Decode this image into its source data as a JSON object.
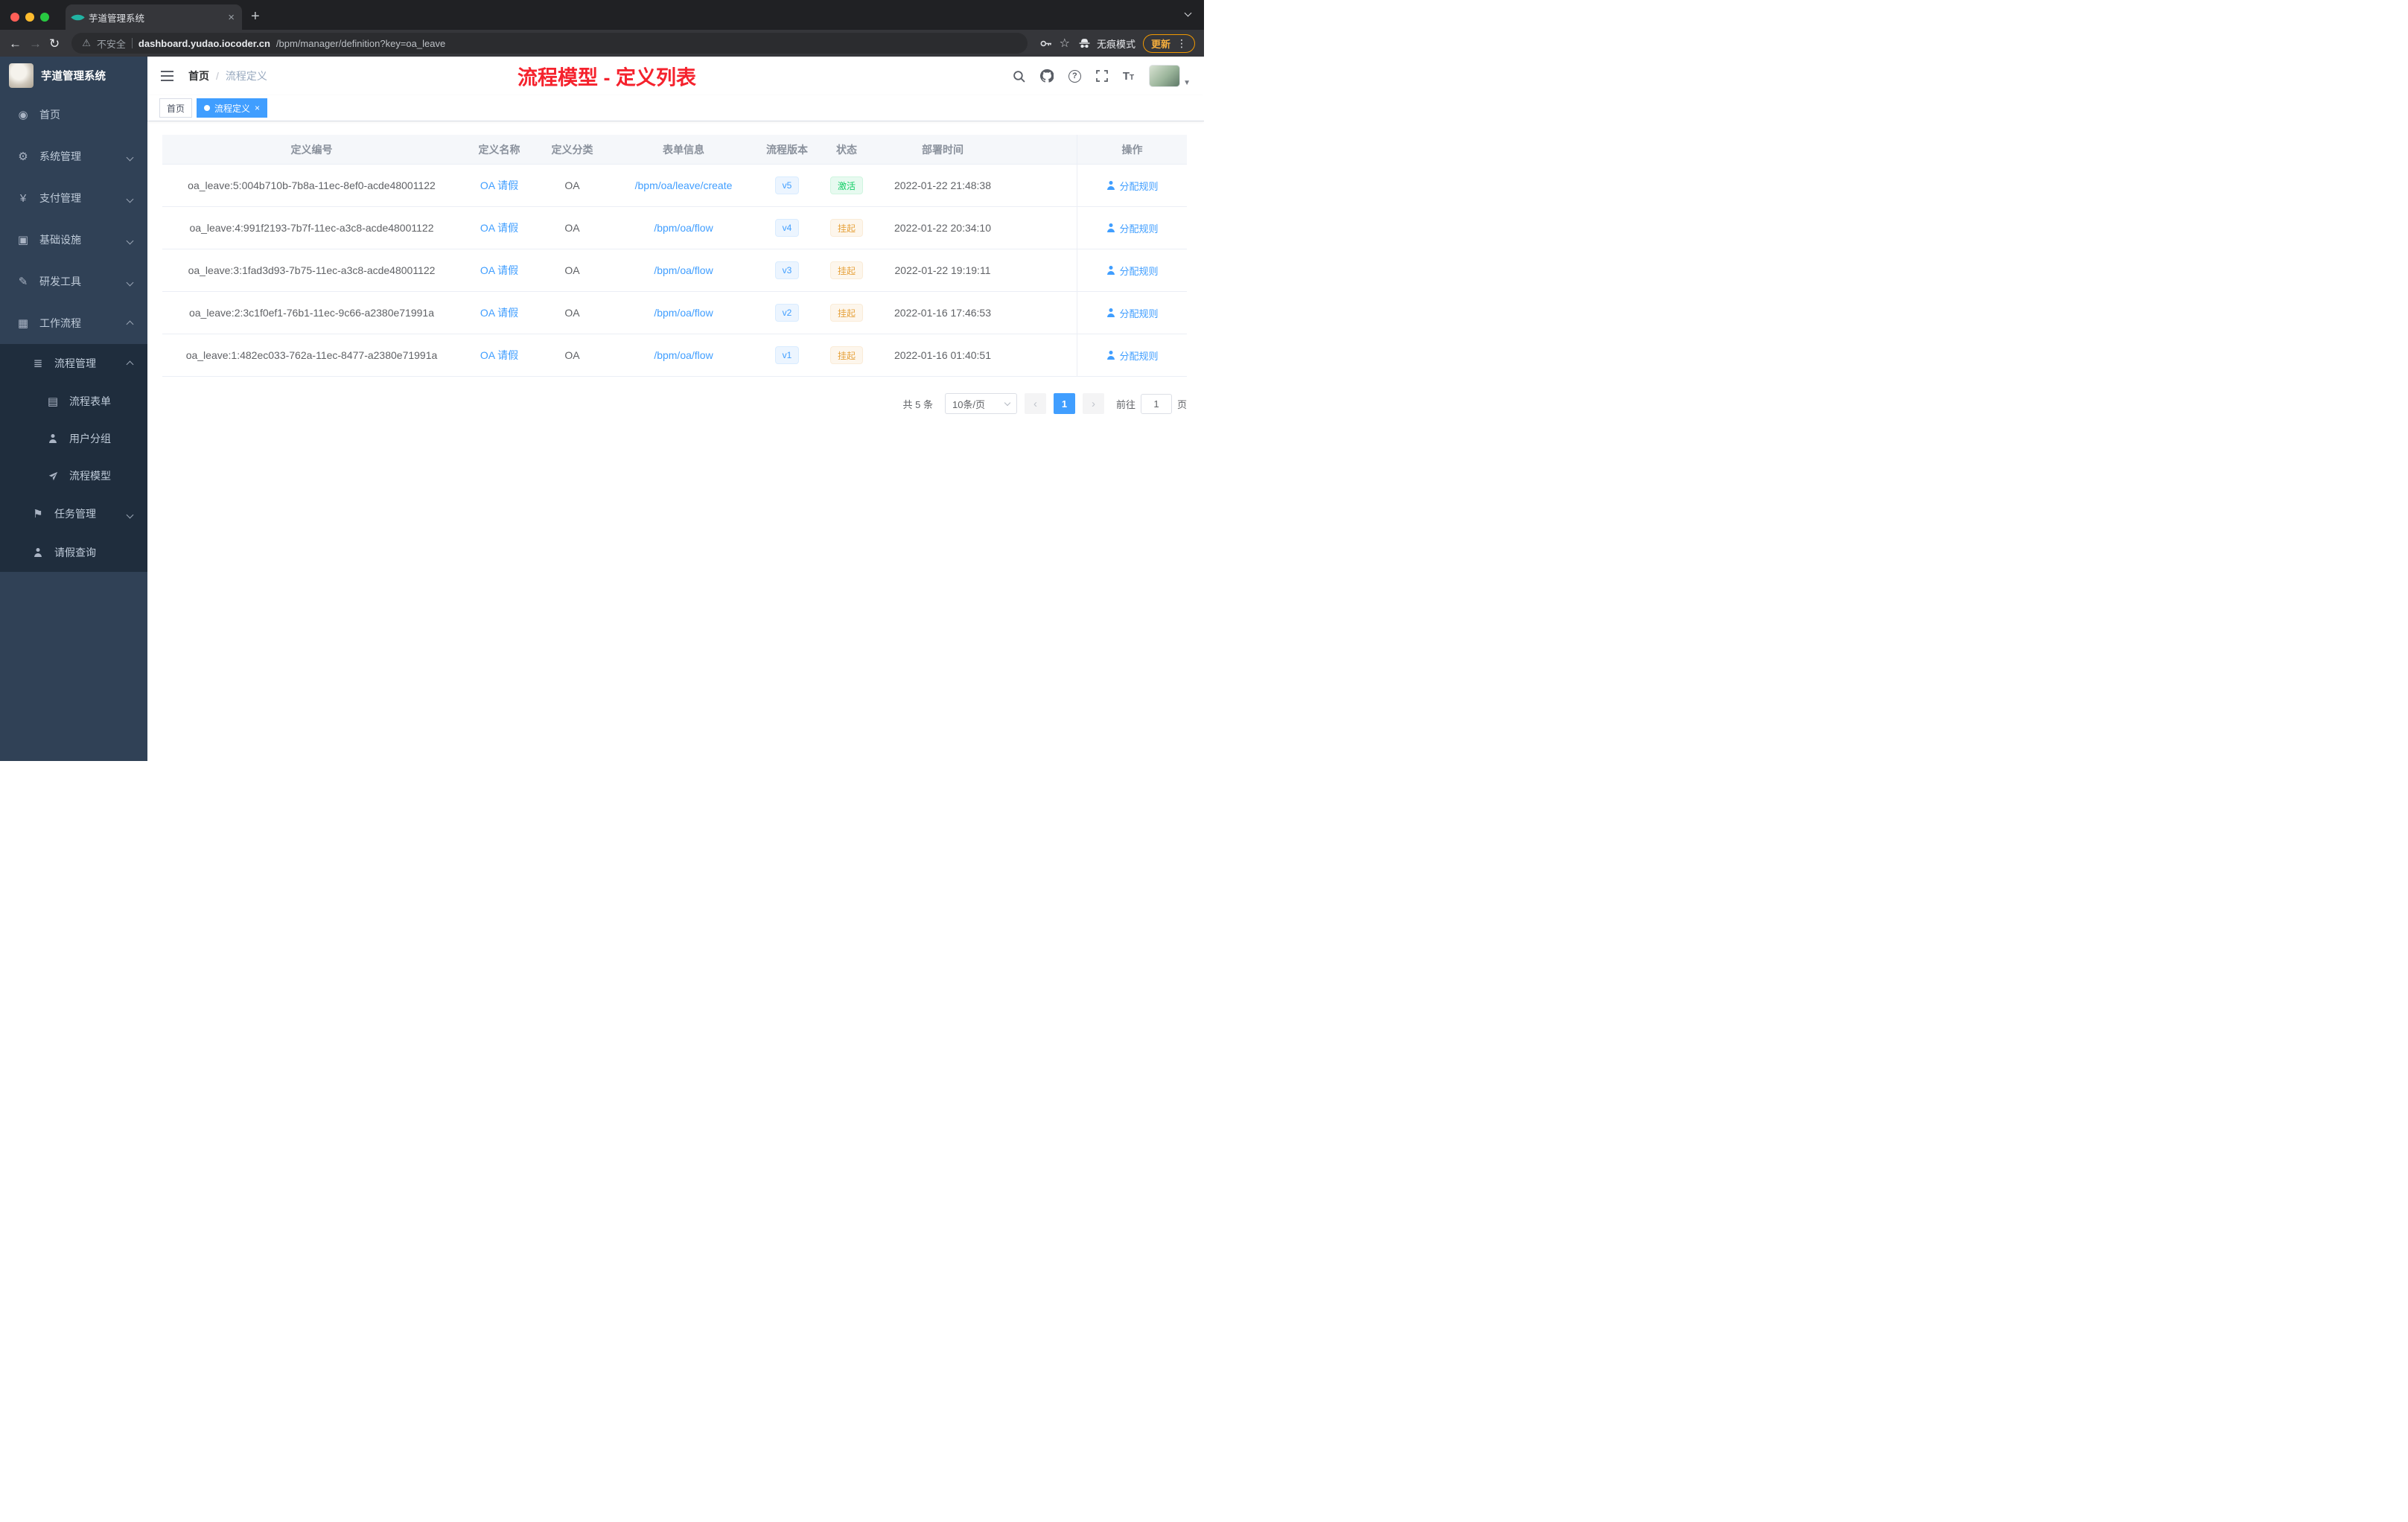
{
  "browser": {
    "tab_title": "芋道管理系统",
    "security_label": "不安全",
    "url_host": "dashboard.yudao.iocoder.cn",
    "url_path": "/bpm/manager/definition?key=oa_leave",
    "incognito_label": "无痕模式",
    "update_label": "更新"
  },
  "sidebar": {
    "logo_title": "芋道管理系统",
    "menu": [
      {
        "label": "首页"
      },
      {
        "label": "系统管理"
      },
      {
        "label": "支付管理"
      },
      {
        "label": "基础设施"
      },
      {
        "label": "研发工具"
      },
      {
        "label": "工作流程"
      }
    ],
    "submenu": [
      {
        "label": "流程管理"
      },
      {
        "label": "流程表单"
      },
      {
        "label": "用户分组"
      },
      {
        "label": "流程模型"
      },
      {
        "label": "任务管理"
      },
      {
        "label": "请假查询"
      }
    ]
  },
  "header": {
    "breadcrumb_home": "首页",
    "breadcrumb_current": "流程定义",
    "page_title": "流程模型 - 定义列表"
  },
  "tags": {
    "home": "首页",
    "active": "流程定义"
  },
  "table": {
    "columns": [
      "定义编号",
      "定义名称",
      "定义分类",
      "表单信息",
      "流程版本",
      "状态",
      "部署时间",
      "操作"
    ],
    "action_label": "分配规则",
    "rows": [
      {
        "id": "oa_leave:5:004b710b-7b8a-11ec-8ef0-acde48001122",
        "name": "OA 请假",
        "category": "OA",
        "form": "/bpm/oa/leave/create",
        "version": "v5",
        "status": "激活",
        "status_type": "success",
        "deploy_time": "2022-01-22 21:48:38"
      },
      {
        "id": "oa_leave:4:991f2193-7b7f-11ec-a3c8-acde48001122",
        "name": "OA 请假",
        "category": "OA",
        "form": "/bpm/oa/flow",
        "version": "v4",
        "status": "挂起",
        "status_type": "warning",
        "deploy_time": "2022-01-22 20:34:10"
      },
      {
        "id": "oa_leave:3:1fad3d93-7b75-11ec-a3c8-acde48001122",
        "name": "OA 请假",
        "category": "OA",
        "form": "/bpm/oa/flow",
        "version": "v3",
        "status": "挂起",
        "status_type": "warning",
        "deploy_time": "2022-01-22 19:19:11"
      },
      {
        "id": "oa_leave:2:3c1f0ef1-76b1-11ec-9c66-a2380e71991a",
        "name": "OA 请假",
        "category": "OA",
        "form": "/bpm/oa/flow",
        "version": "v2",
        "status": "挂起",
        "status_type": "warning",
        "deploy_time": "2022-01-16 17:46:53"
      },
      {
        "id": "oa_leave:1:482ec033-762a-11ec-8477-a2380e71991a",
        "name": "OA 请假",
        "category": "OA",
        "form": "/bpm/oa/flow",
        "version": "v1",
        "status": "挂起",
        "status_type": "warning",
        "deploy_time": "2022-01-16 01:40:51"
      }
    ]
  },
  "pagination": {
    "total": "共 5 条",
    "page_size": "10条/页",
    "current_page": "1",
    "goto_label": "前往",
    "goto_value": "1",
    "page_unit": "页"
  },
  "colors": {
    "accent": "#409eff",
    "success": "#13ce66",
    "warning": "#e6a23c",
    "title_red": "#f5222d",
    "sidebar_bg": "#304156",
    "submenu_bg": "#1f2d3d"
  }
}
